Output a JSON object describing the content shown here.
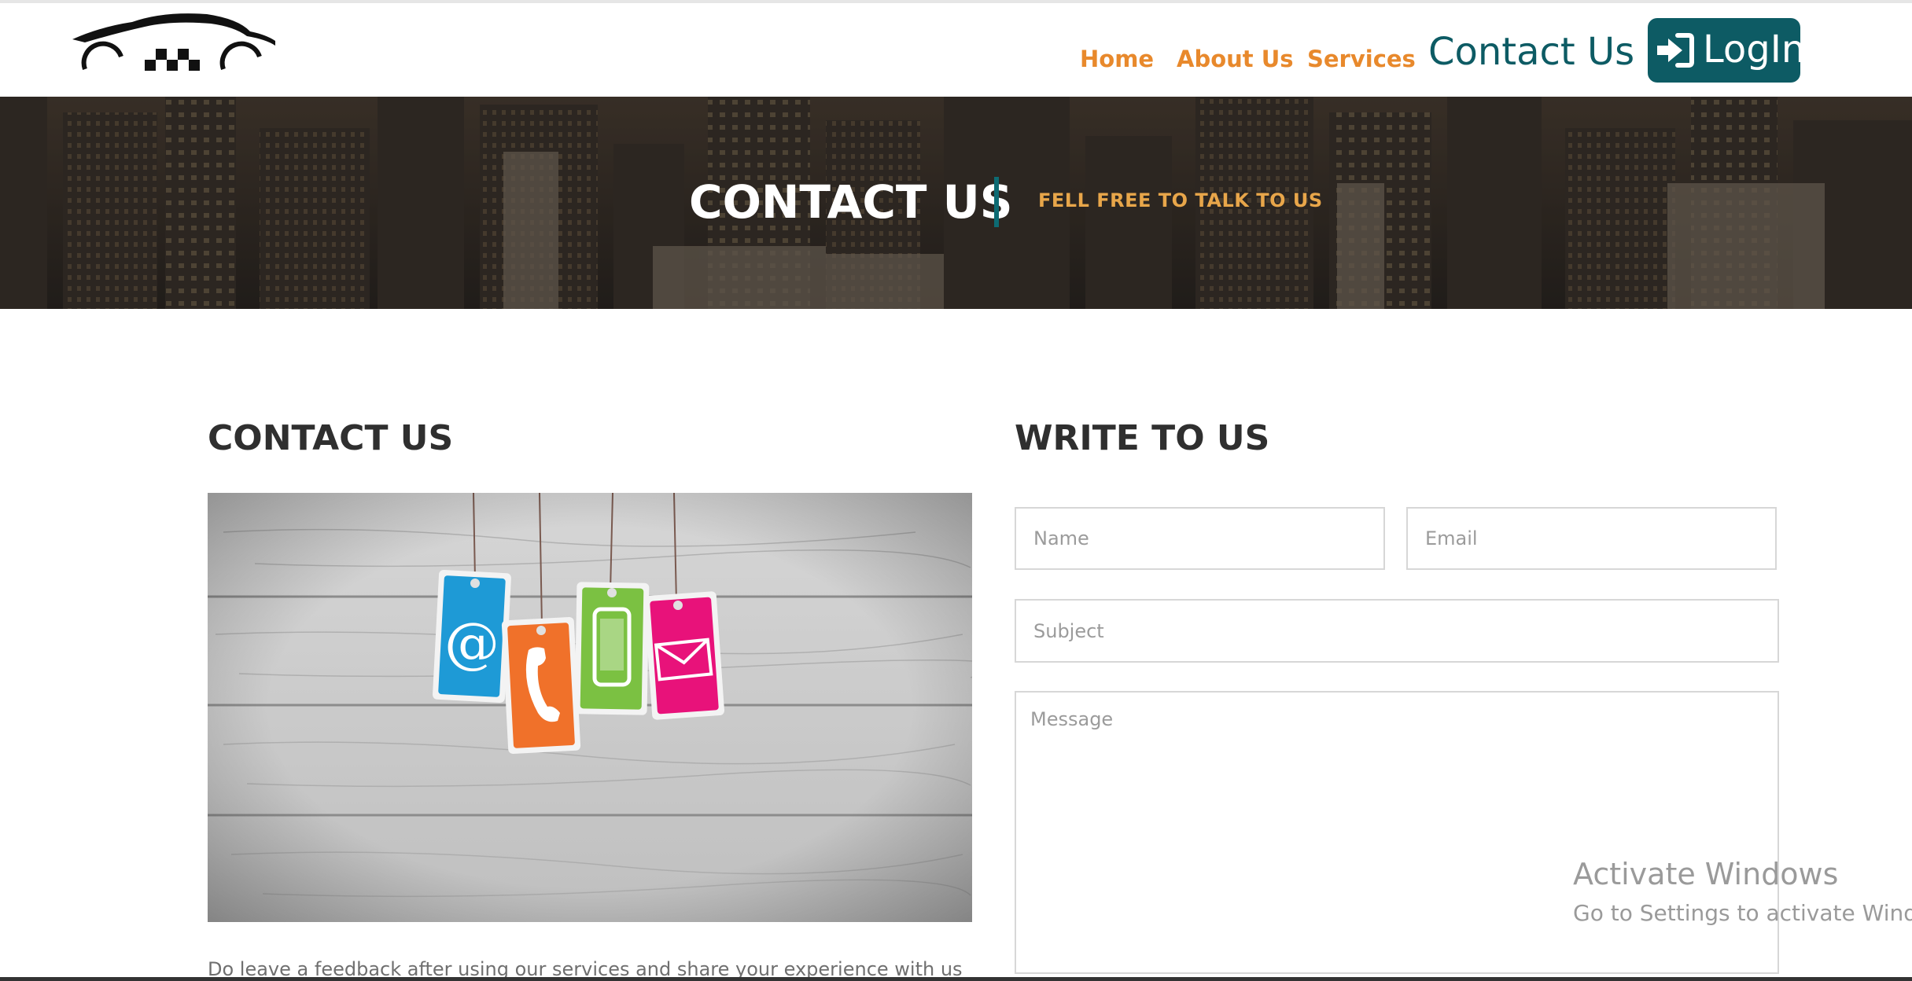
{
  "nav": {
    "items": [
      {
        "label": "Home"
      },
      {
        "label": "About Us"
      },
      {
        "label": "Services"
      },
      {
        "label": "Contact Us"
      }
    ],
    "login_label": "LogIn"
  },
  "hero": {
    "title": "CONTACT US",
    "subtitle": "FELL FREE TO TALK TO US"
  },
  "contact": {
    "title": "CONTACT US",
    "feedback_text": "Do leave a feedback after using our services and share your experience with us"
  },
  "form": {
    "title": "WRITE TO US",
    "name_placeholder": "Name",
    "email_placeholder": "Email",
    "subject_placeholder": "Subject",
    "message_placeholder": "Message"
  },
  "watermark": {
    "line1": "Activate Windows",
    "line2": "Go to Settings to activate Windows."
  },
  "colors": {
    "accent_orange": "#e8892c",
    "brand_teal": "#0d5b64"
  }
}
